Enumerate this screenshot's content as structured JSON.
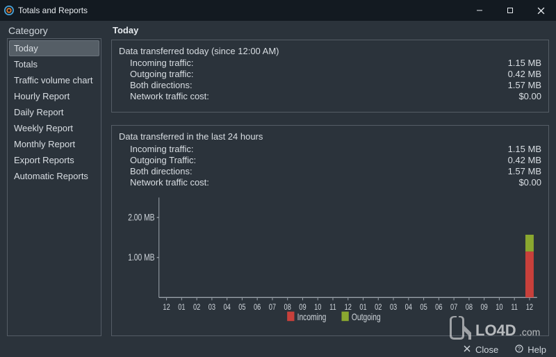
{
  "titlebar": {
    "title": "Totals and Reports"
  },
  "sidebar": {
    "header": "Category",
    "items": [
      {
        "label": "Today",
        "selected": true
      },
      {
        "label": "Totals"
      },
      {
        "label": "Traffic volume chart"
      },
      {
        "label": "Hourly Report"
      },
      {
        "label": "Daily Report"
      },
      {
        "label": "Weekly Report"
      },
      {
        "label": "Monthly Report"
      },
      {
        "label": "Export Reports"
      },
      {
        "label": "Automatic Reports"
      }
    ]
  },
  "main": {
    "title": "Today",
    "panel_today": {
      "heading": "Data transferred today (since 12:00 AM)",
      "rows": [
        {
          "label": "Incoming traffic:",
          "value": "1.15 MB"
        },
        {
          "label": "Outgoing traffic:",
          "value": "0.42 MB"
        },
        {
          "label": "Both directions:",
          "value": "1.57 MB"
        },
        {
          "label": "Network traffic cost:",
          "value": "$0.00"
        }
      ]
    },
    "panel_24h": {
      "heading": "Data transferred in the last 24 hours",
      "rows": [
        {
          "label": "Incoming traffic:",
          "value": "1.15 MB"
        },
        {
          "label": "Outgoing Traffic:",
          "value": "0.42 MB"
        },
        {
          "label": "Both directions:",
          "value": "1.57 MB"
        },
        {
          "label": "Network traffic cost:",
          "value": "$0.00"
        }
      ]
    }
  },
  "chart_data": {
    "type": "bar",
    "categories": [
      "12",
      "01",
      "02",
      "03",
      "04",
      "05",
      "06",
      "07",
      "08",
      "09",
      "10",
      "11",
      "12",
      "01",
      "02",
      "03",
      "04",
      "05",
      "06",
      "07",
      "08",
      "09",
      "10",
      "11",
      "12"
    ],
    "series": [
      {
        "name": "Incoming",
        "values": [
          0,
          0,
          0,
          0,
          0,
          0,
          0,
          0,
          0,
          0,
          0,
          0,
          0,
          0,
          0,
          0,
          0,
          0,
          0,
          0,
          0,
          0,
          0,
          0,
          1.15
        ]
      },
      {
        "name": "Outgoing",
        "values": [
          0,
          0,
          0,
          0,
          0,
          0,
          0,
          0,
          0,
          0,
          0,
          0,
          0,
          0,
          0,
          0,
          0,
          0,
          0,
          0,
          0,
          0,
          0,
          0,
          0.42
        ]
      }
    ],
    "ylabel_ticks": [
      "1.00 MB",
      "2.00 MB"
    ],
    "ylim_mb": [
      0,
      2.5
    ],
    "colors": {
      "Incoming": "#c8403b",
      "Outgoing": "#8aa82f"
    },
    "legend": [
      "Incoming",
      "Outgoing"
    ]
  },
  "footer": {
    "close": "Close",
    "help": "Help"
  },
  "watermark": "LO4D.com"
}
